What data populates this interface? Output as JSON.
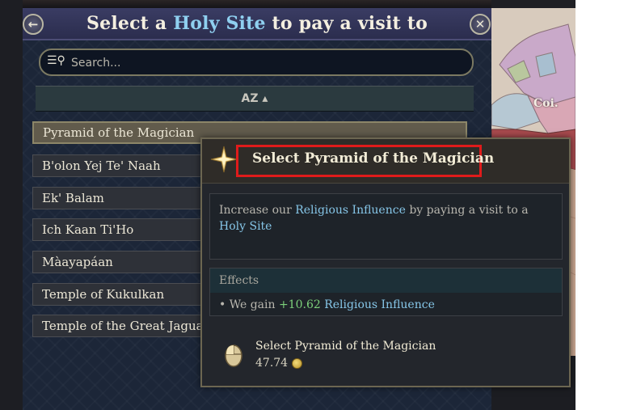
{
  "header": {
    "title_prefix": "Select a ",
    "title_highlight": "Holy Site",
    "title_suffix": " to pay a visit to",
    "back_glyph": "←",
    "close_glyph": "✕"
  },
  "search": {
    "placeholder": "Search...",
    "icon": "filter-search-icon"
  },
  "sort": {
    "icon": "sort-alpha-icon",
    "glyph": "AZ ▴"
  },
  "holy_sites": [
    "Pyramid of the Magician",
    "B'olon Yej Te' Naah",
    "Ek' Balam",
    "Ich Kaan Ti'Ho",
    "Màayapáan",
    "Temple of Kukulkan",
    "Temple of the Great Jaguar"
  ],
  "selected_index": 0,
  "tooltip": {
    "title": "Select Pyramid of the Magician",
    "desc_part1": "Increase our ",
    "desc_hl1": "Religious Influence",
    "desc_part2": " by paying a visit to a ",
    "desc_hl2": "Holy Site",
    "effects_title": "Effects",
    "effect_prefix": "• We gain ",
    "effect_value": "+10.62",
    "effect_target": "Religious Influence",
    "action_label": "Select Pyramid of the Magician",
    "cost": "47.74"
  },
  "map_labels": [
    "Coi."
  ],
  "colors": {
    "accent_blue": "#8fd0f0",
    "positive_green": "#7cd07a",
    "highlight_red": "#e01b1b",
    "coin_gold": "#d9b649"
  }
}
